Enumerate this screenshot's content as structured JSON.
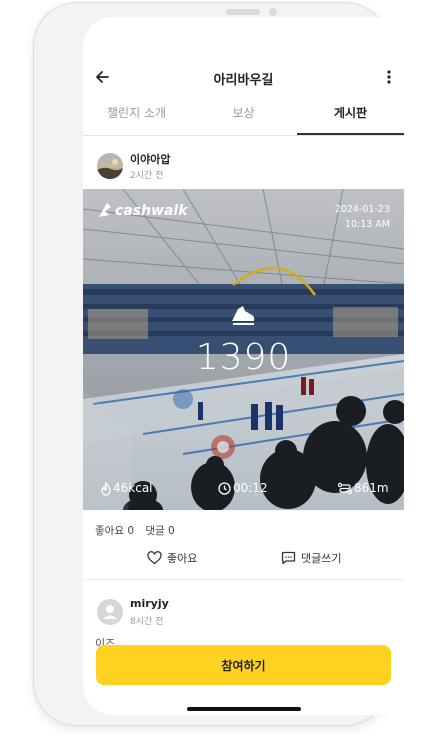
{
  "header": {
    "title": "아리바우길"
  },
  "tabs": [
    {
      "label": "챌린지 소개"
    },
    {
      "label": "보상"
    },
    {
      "label": "게시판"
    }
  ],
  "posts": [
    {
      "username": "이야아압",
      "time": "2시간 전",
      "photo_overlay": {
        "brand": "cashwalk",
        "date": "2024-01-23",
        "time": "10:13 AM",
        "steps": "1390",
        "calories": "46kcal",
        "duration": "00:12",
        "distance": "861m"
      },
      "likes_text": "좋아요 0",
      "comments_text": "댓글 0",
      "like_label": "좋아요",
      "comment_label": "댓글쓰기"
    },
    {
      "username": "miryjy",
      "time": "8시간 전",
      "preview": "이즈"
    }
  ],
  "join_button": {
    "label": "참여하기",
    "color": "#FFD21F"
  },
  "icons": [
    "back-arrow-icon",
    "more-vertical-icon",
    "shoe-icon",
    "heart-icon",
    "comment-icon",
    "flame-icon",
    "clock-icon",
    "route-icon",
    "user-icon"
  ]
}
